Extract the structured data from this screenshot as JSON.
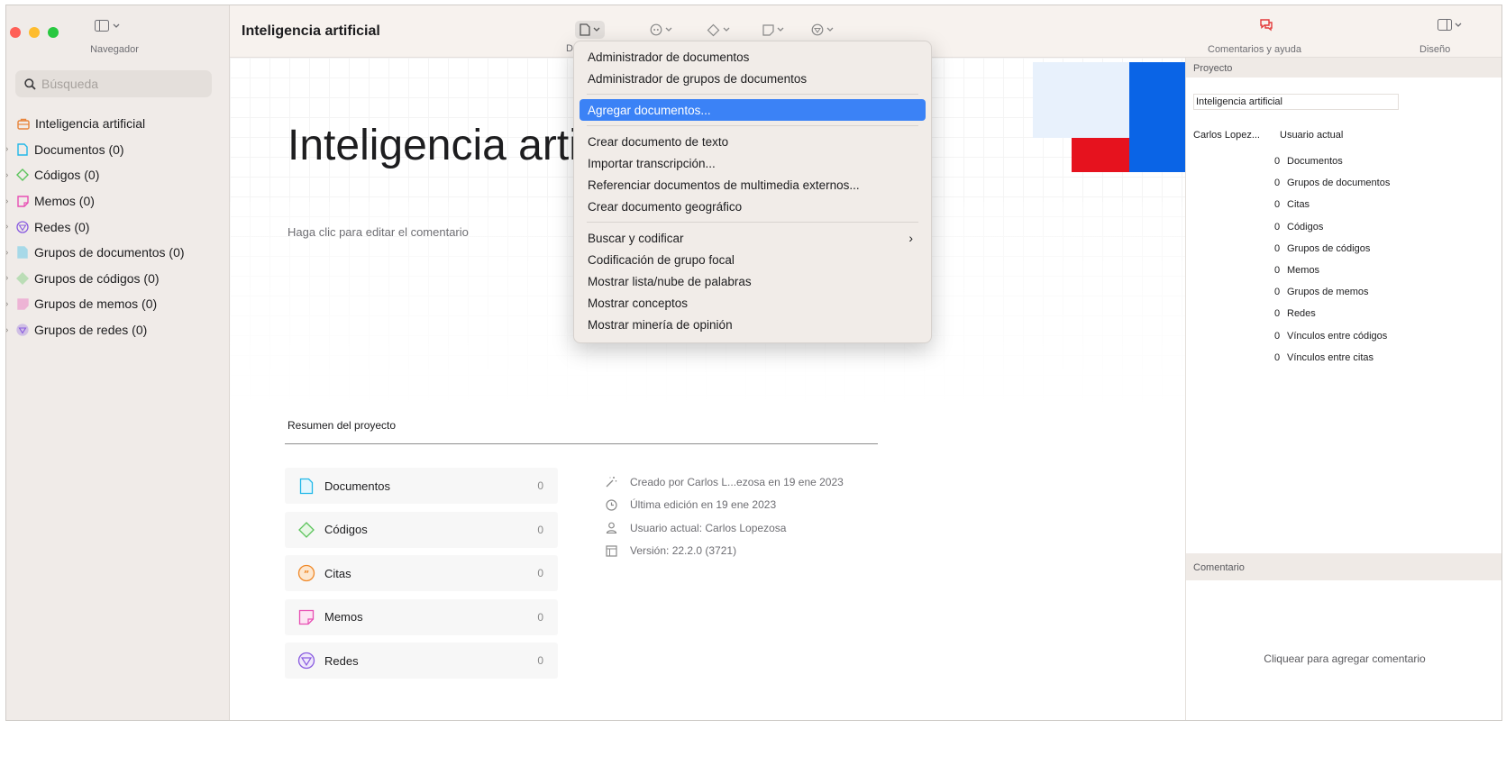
{
  "toolbar": {
    "title": "Inteligencia artificial",
    "doc_label_partial": "Dc",
    "help_label": "Comentarios y ayuda",
    "design_label": "Diseño"
  },
  "sidebar": {
    "navigator_label": "Navegador",
    "search_placeholder": "Búsqueda",
    "items": [
      {
        "label": "Inteligencia artificial",
        "icon": "project-icon",
        "color": "#e8853d"
      },
      {
        "label": "Documentos (0)",
        "icon": "document-icon",
        "color": "#22b8e8"
      },
      {
        "label": "Códigos (0)",
        "icon": "code-icon",
        "color": "#5cc45c"
      },
      {
        "label": "Memos (0)",
        "icon": "memo-icon",
        "color": "#e84fb4"
      },
      {
        "label": "Redes (0)",
        "icon": "network-icon",
        "color": "#8a5ce0"
      },
      {
        "label": "Grupos de documentos (0)",
        "icon": "document-group-icon",
        "color": "#22b8e8"
      },
      {
        "label": "Grupos de códigos (0)",
        "icon": "code-group-icon",
        "color": "#5cc45c"
      },
      {
        "label": "Grupos de memos (0)",
        "icon": "memo-group-icon",
        "color": "#e84fb4"
      },
      {
        "label": "Grupos de redes (0)",
        "icon": "network-group-icon",
        "color": "#8a5ce0"
      }
    ]
  },
  "main": {
    "title": "Inteligencia artificial",
    "comment_hint": "Haga clic para editar el comentario",
    "summary_title": "Resumen del proyecto",
    "stats": [
      {
        "label": "Documentos",
        "value": "0",
        "icon": "document-icon"
      },
      {
        "label": "Códigos",
        "value": "0",
        "icon": "code-icon"
      },
      {
        "label": "Citas",
        "value": "0",
        "icon": "quote-icon"
      },
      {
        "label": "Memos",
        "value": "0",
        "icon": "memo-icon"
      },
      {
        "label": "Redes",
        "value": "0",
        "icon": "network-icon"
      }
    ],
    "meta": [
      {
        "text": "Creado por Carlos L...ezosa en 19 ene 2023",
        "icon": "magic-wand-icon"
      },
      {
        "text": "Última edición en 19 ene 2023",
        "icon": "clock-icon"
      },
      {
        "text": "Usuario actual: Carlos Lopezosa",
        "icon": "user-icon"
      },
      {
        "text": "Versión: 22.2.0 (3721)",
        "icon": "version-icon"
      }
    ]
  },
  "inspector": {
    "project_header": "Proyecto",
    "project_name": "Inteligencia artificial",
    "user_name": "Carlos Lopez...",
    "user_tag": "Usuario actual",
    "stats": [
      {
        "n": "0",
        "label": "Documentos"
      },
      {
        "n": "0",
        "label": "Grupos de documentos"
      },
      {
        "n": "0",
        "label": "Citas"
      },
      {
        "n": "0",
        "label": "Códigos"
      },
      {
        "n": "0",
        "label": "Grupos de códigos"
      },
      {
        "n": "0",
        "label": "Memos"
      },
      {
        "n": "0",
        "label": "Grupos de memos"
      },
      {
        "n": "0",
        "label": "Redes"
      },
      {
        "n": "0",
        "label": "Vínculos entre códigos"
      },
      {
        "n": "0",
        "label": "Vínculos entre citas"
      }
    ],
    "comment_header": "Comentario",
    "comment_hint": "Cliquear para agregar comentario"
  },
  "menu": {
    "groups": [
      [
        "Administrador de documentos",
        "Administrador de grupos de documentos"
      ],
      [
        "Agregar documentos..."
      ],
      [
        "Crear documento de texto",
        "Importar transcripción...",
        "Referenciar documentos de multimedia externos...",
        "Crear documento geográfico"
      ],
      [
        "Buscar y codificar",
        "Codificación de grupo focal",
        "Mostrar lista/nube de palabras",
        "Mostrar conceptos",
        "Mostrar minería de opinión"
      ]
    ],
    "highlighted": "Agregar documentos...",
    "submenu_item": "Buscar y codificar"
  },
  "colors": {
    "accent": "#3b82f6",
    "block_light": "#e8f1fc",
    "block_blue": "#0a64e6",
    "block_red": "#e6121e"
  }
}
